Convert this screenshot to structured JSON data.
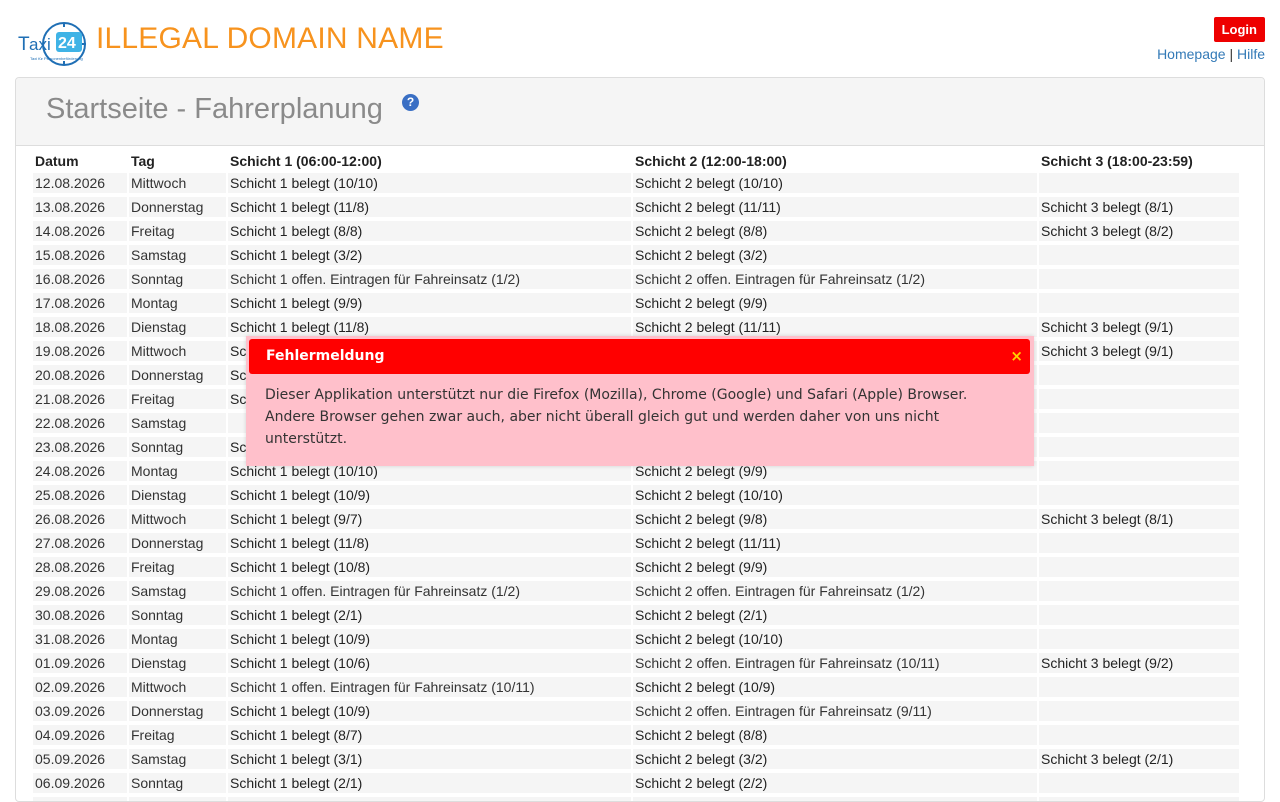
{
  "header": {
    "logo_text": "Taxi24",
    "logo_tagline": "Taxi für Personenbeförderung",
    "site_title": "ILLEGAL DOMAIN NAME",
    "login_label": "Login",
    "links": {
      "homepage": "Homepage",
      "separator": "|",
      "help": "Hilfe"
    }
  },
  "panel": {
    "title": "Startseite - Fahrerplanung",
    "help_icon": "?"
  },
  "table": {
    "headers": [
      "Datum",
      "Tag",
      "Schicht 1 (06:00-12:00)",
      "Schicht 2 (12:00-18:00)",
      "Schicht 3 (18:00-23:59)"
    ],
    "rows": [
      {
        "date": "12.08.2026",
        "day": "Mittwoch",
        "s1": "Schicht 1 belegt (10/10)",
        "s2": "Schicht 2 belegt (10/10)",
        "s3": ""
      },
      {
        "date": "13.08.2026",
        "day": "Donnerstag",
        "s1": "Schicht 1 belegt (11/8)",
        "s2": "Schicht 2 belegt (11/11)",
        "s3": "Schicht 3 belegt (8/1)"
      },
      {
        "date": "14.08.2026",
        "day": "Freitag",
        "s1": "Schicht 1 belegt (8/8)",
        "s2": "Schicht 2 belegt (8/8)",
        "s3": "Schicht 3 belegt (8/2)"
      },
      {
        "date": "15.08.2026",
        "day": "Samstag",
        "s1": "Schicht 1 belegt (3/2)",
        "s2": "Schicht 2 belegt (3/2)",
        "s3": ""
      },
      {
        "date": "16.08.2026",
        "day": "Sonntag",
        "s1": "Schicht 1 offen. Eintragen für Fahreinsatz (1/2)",
        "s2": "Schicht 2 offen. Eintragen für Fahreinsatz (1/2)",
        "s3": ""
      },
      {
        "date": "17.08.2026",
        "day": "Montag",
        "s1": "Schicht 1 belegt (9/9)",
        "s2": "Schicht 2 belegt (9/9)",
        "s3": ""
      },
      {
        "date": "18.08.2026",
        "day": "Dienstag",
        "s1": "Schicht 1 belegt (11/8)",
        "s2": "Schicht 2 belegt (11/11)",
        "s3": "Schicht 3 belegt (9/1)"
      },
      {
        "date": "19.08.2026",
        "day": "Mittwoch",
        "s1": "Sc",
        "s2": "",
        "s3": "Schicht 3 belegt (9/1)"
      },
      {
        "date": "20.08.2026",
        "day": "Donnerstag",
        "s1": "Sc",
        "s2": "",
        "s3": ""
      },
      {
        "date": "21.08.2026",
        "day": "Freitag",
        "s1": "Sc",
        "s2": "",
        "s3": ""
      },
      {
        "date": "22.08.2026",
        "day": "Samstag",
        "s1": "",
        "s2": "",
        "s3": ""
      },
      {
        "date": "23.08.2026",
        "day": "Sonntag",
        "s1": "Sc",
        "s2": "",
        "s3": ""
      },
      {
        "date": "24.08.2026",
        "day": "Montag",
        "s1": "Schicht 1 belegt (10/10)",
        "s2": "Schicht 2 belegt (9/9)",
        "s3": ""
      },
      {
        "date": "25.08.2026",
        "day": "Dienstag",
        "s1": "Schicht 1 belegt (10/9)",
        "s2": "Schicht 2 belegt (10/10)",
        "s3": ""
      },
      {
        "date": "26.08.2026",
        "day": "Mittwoch",
        "s1": "Schicht 1 belegt (9/7)",
        "s2": "Schicht 2 belegt (9/8)",
        "s3": "Schicht 3 belegt (8/1)"
      },
      {
        "date": "27.08.2026",
        "day": "Donnerstag",
        "s1": "Schicht 1 belegt (11/8)",
        "s2": "Schicht 2 belegt (11/11)",
        "s3": ""
      },
      {
        "date": "28.08.2026",
        "day": "Freitag",
        "s1": "Schicht 1 belegt (10/8)",
        "s2": "Schicht 2 belegt (9/9)",
        "s3": ""
      },
      {
        "date": "29.08.2026",
        "day": "Samstag",
        "s1": "Schicht 1 offen. Eintragen für Fahreinsatz (1/2)",
        "s2": "Schicht 2 offen. Eintragen für Fahreinsatz (1/2)",
        "s3": ""
      },
      {
        "date": "30.08.2026",
        "day": "Sonntag",
        "s1": "Schicht 1 belegt (2/1)",
        "s2": "Schicht 2 belegt (2/1)",
        "s3": ""
      },
      {
        "date": "31.08.2026",
        "day": "Montag",
        "s1": "Schicht 1 belegt (10/9)",
        "s2": "Schicht 2 belegt (10/10)",
        "s3": ""
      },
      {
        "date": "01.09.2026",
        "day": "Dienstag",
        "s1": "Schicht 1 belegt (10/6)",
        "s2": "Schicht 2 offen. Eintragen für Fahreinsatz (10/11)",
        "s3": "Schicht 3 belegt (9/2)"
      },
      {
        "date": "02.09.2026",
        "day": "Mittwoch",
        "s1": "Schicht 1 offen. Eintragen für Fahreinsatz (10/11)",
        "s2": "Schicht 2 belegt (10/9)",
        "s3": ""
      },
      {
        "date": "03.09.2026",
        "day": "Donnerstag",
        "s1": "Schicht 1 belegt (10/9)",
        "s2": "Schicht 2 offen. Eintragen für Fahreinsatz (9/11)",
        "s3": ""
      },
      {
        "date": "04.09.2026",
        "day": "Freitag",
        "s1": "Schicht 1 belegt (8/7)",
        "s2": "Schicht 2 belegt (8/8)",
        "s3": ""
      },
      {
        "date": "05.09.2026",
        "day": "Samstag",
        "s1": "Schicht 1 belegt (3/1)",
        "s2": "Schicht 2 belegt (3/2)",
        "s3": "Schicht 3 belegt (2/1)"
      },
      {
        "date": "06.09.2026",
        "day": "Sonntag",
        "s1": "Schicht 1 belegt (2/1)",
        "s2": "Schicht 2 belegt (2/2)",
        "s3": ""
      },
      {
        "date": "",
        "day": "",
        "s1": "",
        "s2": "",
        "s3": ""
      }
    ]
  },
  "modal": {
    "title": "Fehlermeldung",
    "close_icon": "×",
    "line1": "Dieser Applikation unterstützt nur die Firefox (Mozilla), Chrome (Google) und Safari (Apple) Browser.",
    "line2": "Andere Browser gehen zwar auch, aber nicht überall gleich gut und werden daher von uns nicht unterstützt."
  },
  "colors": {
    "occupied": "#b3ff99",
    "open": "#ffcccc",
    "empty": "#f5f5f5",
    "brand_orange": "#f7931e",
    "login_red": "#ee0000",
    "modal_header": "#ff0000",
    "modal_bg": "#ffc0cb"
  }
}
